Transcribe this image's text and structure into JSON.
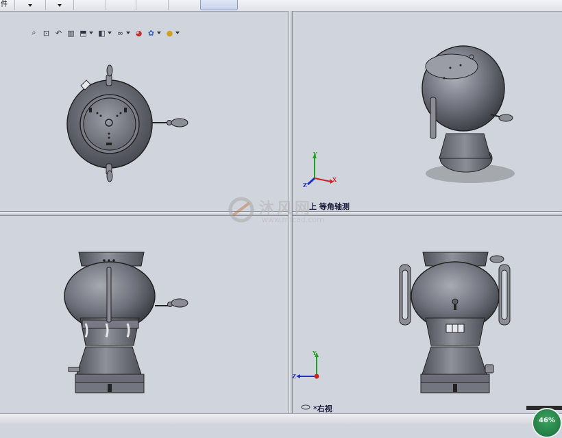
{
  "menu": {
    "first_tab": "件",
    "tabs": [
      "",
      "",
      "",
      "",
      ""
    ]
  },
  "toolbar": {
    "icons": [
      "zoom-to-fit-icon",
      "zoom-to-area-icon",
      "previous-view-icon",
      "section-view-icon",
      "view-orientation-icon",
      "display-style-icon",
      "hide-show-items-icon",
      "edit-appearance-icon",
      "apply-scene-icon",
      "view-settings-icon"
    ]
  },
  "viewports": {
    "top_left": {
      "label": ""
    },
    "top_right": {
      "label": "上 等角轴测",
      "triad": {
        "x": "X",
        "y": "Y",
        "z": "Z"
      }
    },
    "bottom_left": {
      "label": ""
    },
    "bottom_right": {
      "label": "*右视",
      "triad": {
        "y": "Y",
        "z": "Z"
      }
    }
  },
  "watermark": {
    "text": "沐风网",
    "url": "www.mfcad.com"
  },
  "status": {
    "progress_percent": "46%",
    "progress_value": 0.46
  },
  "colors": {
    "background": "#d0d4dc",
    "model": "#6b6e78",
    "x_axis": "#d02020",
    "y_axis": "#20a020",
    "z_axis": "#2030c0"
  }
}
